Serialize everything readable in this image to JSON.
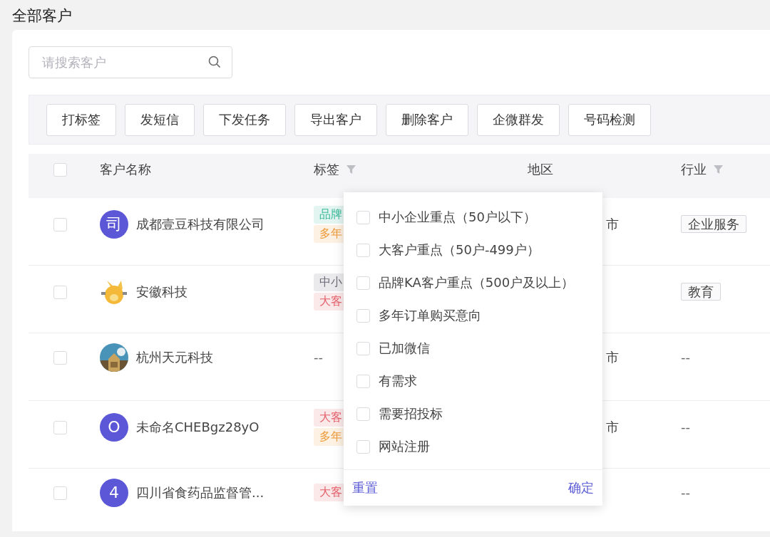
{
  "page_title": "全部客户",
  "search": {
    "placeholder": "请搜索客户"
  },
  "toolbar_buttons": [
    "打标签",
    "发短信",
    "下发任务",
    "导出客户",
    "删除客户",
    "企微群发",
    "号码检测"
  ],
  "table": {
    "select_all": {
      "checked": false
    },
    "columns": [
      {
        "label": "客户名称",
        "filter": false
      },
      {
        "label": "标签",
        "filter": true
      },
      {
        "label": "地区",
        "filter": false
      },
      {
        "label": "行业",
        "filter": true
      }
    ],
    "rows": [
      {
        "checked": false,
        "avatar": {
          "kind": "letter",
          "text": "司"
        },
        "name": "成都壹豆科技有限公司",
        "tags": [
          {
            "text": "品牌",
            "color": "#3cb99a"
          },
          {
            "text": "多年",
            "color": "#ee9a3a"
          }
        ],
        "region": "市",
        "industry": {
          "kind": "tag",
          "text": "企业服务"
        }
      },
      {
        "checked": false,
        "name": "安徽科技",
        "tags": [
          {
            "text": "中小",
            "color": "#6b6b78"
          },
          {
            "text": "大客",
            "color": "#e5606b"
          }
        ],
        "industry": {
          "kind": "tag",
          "text": "教育"
        }
      },
      {
        "checked": false,
        "name": "杭州天元科技",
        "tags_text": "--",
        "region": "市",
        "industry": {
          "kind": "plain",
          "text": "--"
        }
      },
      {
        "checked": false,
        "avatar": {
          "kind": "letter",
          "text": "O"
        },
        "name": "未命名CHEBgz28yO",
        "tags": [
          {
            "text": "大客",
            "color": "#e5606b"
          },
          {
            "text": "多年",
            "color": "#ee9a3a"
          }
        ],
        "region": "市",
        "industry": {
          "kind": "plain",
          "text": "--"
        }
      },
      {
        "checked": false,
        "avatar": {
          "kind": "letter",
          "text": "4"
        },
        "name": "四川省食药品监督管...",
        "tags": [
          {
            "text": "大客",
            "color": "#e5606b"
          }
        ],
        "industry": {
          "kind": "plain",
          "text": "--"
        }
      }
    ]
  },
  "tag_filter": {
    "options": [
      {
        "label": "中小企业重点（50户以下）",
        "checked": false
      },
      {
        "label": "大客户重点（50户-499户）",
        "checked": false
      },
      {
        "label": "品牌KA客户重点（500户及以上）",
        "checked": false
      },
      {
        "label": "多年订单购买意向",
        "checked": false
      },
      {
        "label": "已加微信",
        "checked": false
      },
      {
        "label": "有需求",
        "checked": false
      },
      {
        "label": "需要招投标",
        "checked": false
      },
      {
        "label": "网站注册",
        "checked": false
      }
    ],
    "reset": "重置",
    "confirm": "确定"
  }
}
